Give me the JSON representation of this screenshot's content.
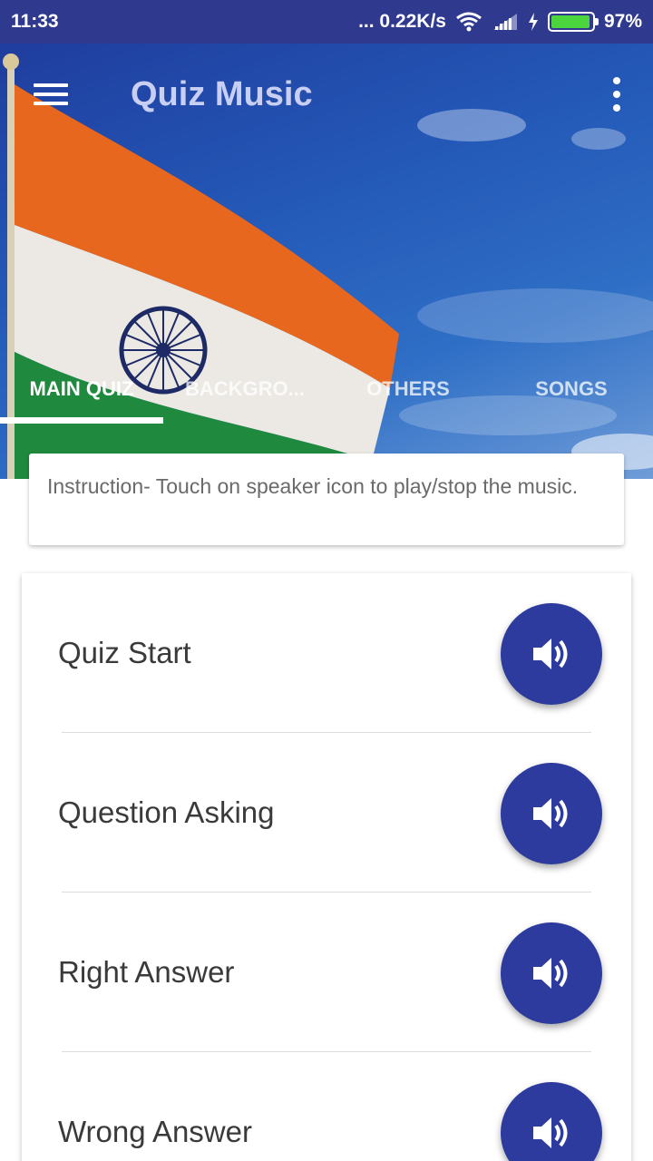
{
  "status_bar": {
    "time": "11:33",
    "net_speed": "... 0.22K/s",
    "battery": "97%",
    "battery_level": 0.97
  },
  "app_bar": {
    "title": "Quiz Music",
    "menu_icon": "hamburger-menu-icon",
    "overflow_icon": "more-vert-icon"
  },
  "tabs": [
    {
      "label": "MAIN QUIZ",
      "selected": true
    },
    {
      "label": "BACKGRO...",
      "selected": false
    },
    {
      "label": "OTHERS",
      "selected": false
    },
    {
      "label": "SONGS",
      "selected": false
    }
  ],
  "instruction": "Instruction- Touch on speaker icon to play/stop the music.",
  "sounds": [
    {
      "label": "Quiz Start",
      "icon": "speaker-icon"
    },
    {
      "label": "Question Asking",
      "icon": "speaker-icon"
    },
    {
      "label": "Right Answer",
      "icon": "speaker-icon"
    },
    {
      "label": "Wrong Answer",
      "icon": "speaker-icon"
    }
  ],
  "colors": {
    "primary": "#2f3a8f",
    "accent_button": "#2e3b9e",
    "tab_indicator": "#ffffff"
  }
}
